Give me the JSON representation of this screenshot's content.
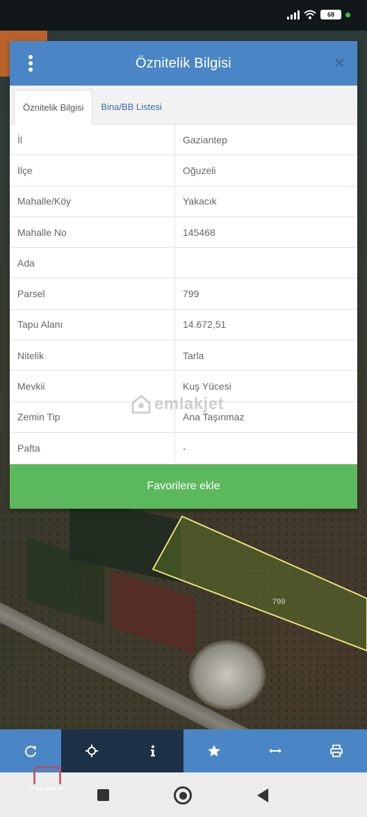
{
  "status_bar": {
    "battery": "68"
  },
  "dialog": {
    "title": "Öznitelik Bilgisi",
    "close_symbol": "×",
    "tabs": [
      {
        "label": "Öznitelik Bilgisi",
        "active": true
      },
      {
        "label": "Bina/BB Listesi",
        "active": false
      }
    ],
    "rows": [
      {
        "key": "İl",
        "value": "Gaziantep"
      },
      {
        "key": "İlçe",
        "value": "Oğuzeli"
      },
      {
        "key": "Mahalle/Köy",
        "value": "Yakacık"
      },
      {
        "key": "Mahalle No",
        "value": "145468"
      },
      {
        "key": "Ada",
        "value": ""
      },
      {
        "key": "Parsel",
        "value": "799"
      },
      {
        "key": "Tapu Alanı",
        "value": "14.672,51"
      },
      {
        "key": "Nitelik",
        "value": "Tarla"
      },
      {
        "key": "Mevkii",
        "value": "Kuş Yücesi"
      },
      {
        "key": "Zemin Tip",
        "value": "Ana Taşınmaz"
      },
      {
        "key": "Pafta",
        "value": "-"
      }
    ],
    "favorite_button": "Favorilere ekle"
  },
  "watermark": "emlakjet",
  "map": {
    "parcel_label": "799"
  },
  "toolbar": {
    "items": [
      {
        "icon": "refresh-icon",
        "active": false
      },
      {
        "icon": "locate-icon",
        "active": true
      },
      {
        "icon": "info-icon",
        "active": true
      },
      {
        "icon": "star-icon",
        "active": false
      },
      {
        "icon": "measure-icon",
        "active": false
      },
      {
        "icon": "print-icon",
        "active": false
      }
    ],
    "active_color": "#1d3146",
    "color": "#4a86c5"
  },
  "brand_logo_text": "UTKU EMLAK",
  "colors": {
    "header": "#4a86c5",
    "favorite_button": "#5cb85c",
    "tab_link": "#3a6aa4"
  }
}
